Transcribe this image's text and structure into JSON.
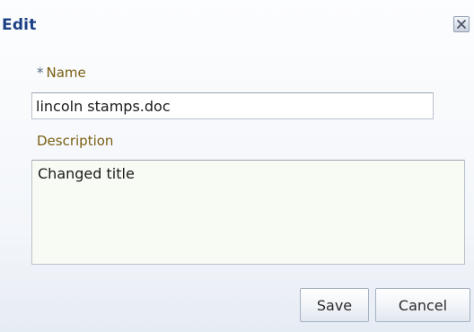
{
  "dialog": {
    "title": "Edit",
    "close_icon": "close-x-icon"
  },
  "form": {
    "name_required_marker": "*",
    "name_label": "Name",
    "name_value": "lincoln stamps.doc",
    "description_label": "Description",
    "description_value": "Changed title"
  },
  "buttons": {
    "save_label": "Save",
    "cancel_label": "Cancel"
  },
  "colors": {
    "title": "#1c3f86",
    "label": "#7a5e12",
    "description_bg": "#f8fbf4"
  }
}
